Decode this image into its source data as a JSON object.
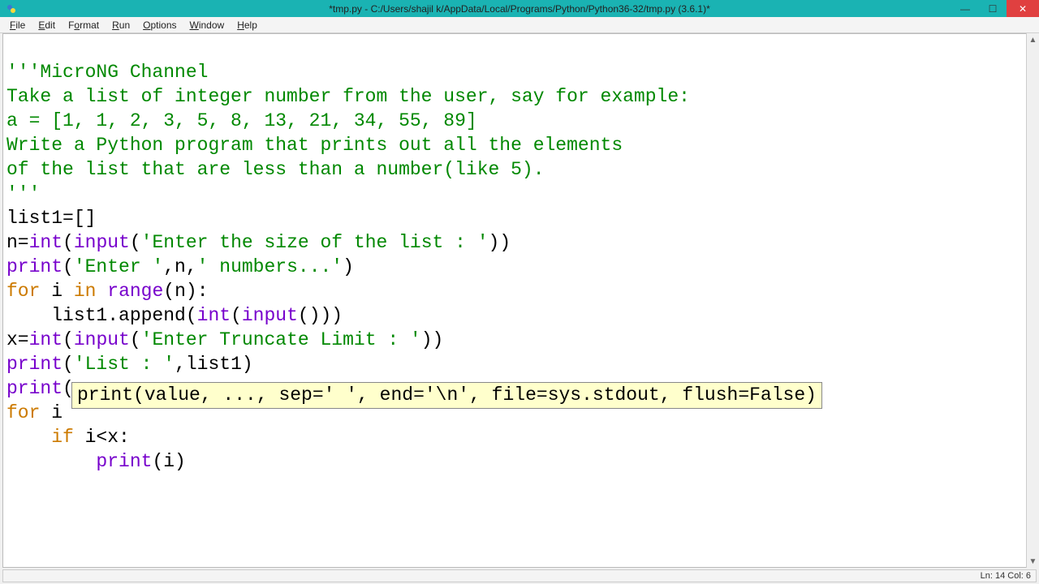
{
  "titlebar": {
    "title": "*tmp.py - C:/Users/shajil k/AppData/Local/Programs/Python/Python36-32/tmp.py (3.6.1)*"
  },
  "menu": {
    "file": "File",
    "edit": "Edit",
    "format": "Format",
    "run": "Run",
    "options": "Options",
    "window": "Window",
    "help": "Help"
  },
  "code": {
    "l1": "'''MicroNG Channel",
    "l2": "Take a list of integer number from the user, say for example:",
    "l3": "a = [1, 1, 2, 3, 5, 8, 13, 21, 34, 55, 89]",
    "l4": "Write a Python program that prints out all the elements",
    "l5": "of the list that are less than a number(like 5).",
    "l6": "'''",
    "l7_a": "list1=[]",
    "l8_a": "n=",
    "l8_b": "int",
    "l8_c": "(",
    "l8_d": "input",
    "l8_e": "(",
    "l8_f": "'Enter the size of the list : '",
    "l8_g": "))",
    "l9_a": "print",
    "l9_b": "(",
    "l9_c": "'Enter '",
    "l9_d": ",n,",
    "l9_e": "' numbers...'",
    "l9_f": ")",
    "l10_a": "for",
    "l10_b": " i ",
    "l10_c": "in",
    "l10_d": " ",
    "l10_e": "range",
    "l10_f": "(n):",
    "l11_a": "    list1.append(",
    "l11_b": "int",
    "l11_c": "(",
    "l11_d": "input",
    "l11_e": "()))",
    "l12_a": "x=",
    "l12_b": "int",
    "l12_c": "(",
    "l12_d": "input",
    "l12_e": "(",
    "l12_f": "'Enter Truncate Limit : '",
    "l12_g": "))",
    "l13_a": "print",
    "l13_b": "(",
    "l13_c": "'List : '",
    "l13_d": ",list1)",
    "l14_a": "print",
    "l14_b": "(",
    "l15_a": "for",
    "l15_b": " i",
    "l16_a": "    ",
    "l16_b": "if",
    "l16_c": " i<x:",
    "l17_a": "        ",
    "l17_b": "print",
    "l17_c": "(i)"
  },
  "tooltip": {
    "text": "print(value, ..., sep=' ', end='\\n', file=sys.stdout, flush=False)"
  },
  "status": {
    "text": "Ln: 14  Col: 6"
  }
}
